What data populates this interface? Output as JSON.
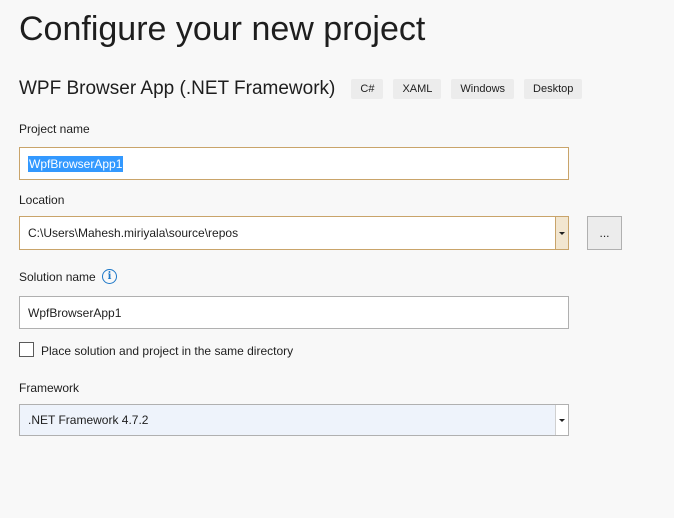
{
  "page": {
    "title": "Configure your new project"
  },
  "template": {
    "name": "WPF Browser App (.NET Framework)",
    "tags": [
      "C#",
      "XAML",
      "Windows",
      "Desktop"
    ]
  },
  "form": {
    "project_name": {
      "label": "Project name",
      "value": "WpfBrowserApp1"
    },
    "location": {
      "label": "Location",
      "value": "C:\\Users\\Mahesh.miriyala\\source\\repos",
      "browse_label": "..."
    },
    "solution_name": {
      "label": "Solution name",
      "value": "WpfBrowserApp1",
      "info_glyph": "i"
    },
    "same_directory": {
      "label": "Place solution and project in the same directory",
      "checked": false
    },
    "framework": {
      "label": "Framework",
      "value": ".NET Framework 4.7.2"
    }
  },
  "icons": {
    "info": "info-icon",
    "dropdown": "chevron-down-icon"
  },
  "colors": {
    "focus_border": "#c9a46a",
    "selection": "#3399ff",
    "info_blue": "#1e78c8"
  }
}
